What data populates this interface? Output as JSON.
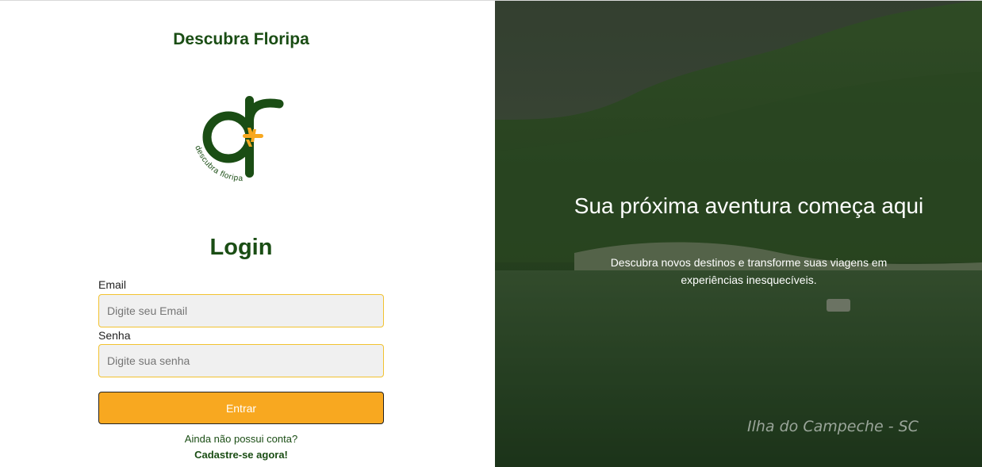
{
  "brand": {
    "title": "Descubra Floripa",
    "logo_text": "descubra floripa",
    "logo_letters": "df"
  },
  "login": {
    "title": "Login",
    "email_label": "Email",
    "email_placeholder": "Digite seu Email",
    "password_label": "Senha",
    "password_placeholder": "Digite sua senha",
    "submit_label": "Entrar",
    "signup_question": "Ainda não possui conta?",
    "signup_link": "Cadastre-se agora!"
  },
  "hero": {
    "title": "Sua próxima aventura começa aqui",
    "subtitle": "Descubra novos destinos e transforme suas viagens em experiências inesquecíveis.",
    "caption": "Ilha do Campeche - SC"
  },
  "colors": {
    "brand_green": "#1a4d14",
    "accent_orange": "#f8a820",
    "input_border": "#f2c230"
  }
}
